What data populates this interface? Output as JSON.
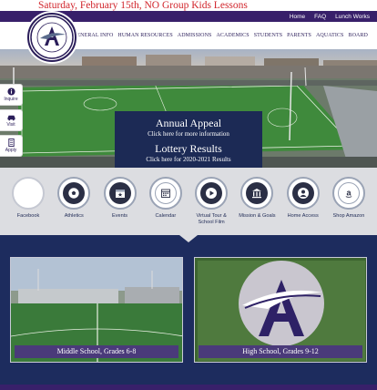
{
  "alert": {
    "text": "Saturday, February 15th, NO Group Kids Lessons"
  },
  "topbar": {
    "links": [
      "Home",
      "FAQ",
      "Lunch Works"
    ]
  },
  "logo": {
    "arc_text": "Nuusa Academy",
    "mascot_text": "Seahawks"
  },
  "nav": {
    "items": [
      "GENERAL INFO",
      "HUMAN RESOURCES",
      "ADMISSIONS",
      "ACADEMICS",
      "STUDENTS",
      "PARENTS",
      "AQUATICS",
      "BOARD"
    ]
  },
  "side_buttons": [
    {
      "label": "Inquire",
      "icon": "info-icon"
    },
    {
      "label": "Visit",
      "icon": "car-icon"
    },
    {
      "label": "Apply",
      "icon": "form-icon"
    }
  ],
  "appeal": {
    "title1": "Annual Appeal",
    "sub1": "Click here for more information",
    "title2": "Lottery Results",
    "sub2": "Click here for 2020-2021 Results"
  },
  "quick_links": [
    {
      "label": "Facebook",
      "icon": "facebook-icon"
    },
    {
      "label": "Athletics",
      "icon": "soccer-ball-icon"
    },
    {
      "label": "Events",
      "icon": "calendar-star-icon"
    },
    {
      "label": "Calendar",
      "icon": "calendar-icon"
    },
    {
      "label": "Virtual Tour & School Film",
      "icon": "play-icon"
    },
    {
      "label": "Mission & Goals",
      "icon": "building-icon"
    },
    {
      "label": "Home Access",
      "icon": "user-icon"
    },
    {
      "label": "Shop Amazon",
      "icon": "amazon-icon"
    }
  ],
  "cards": [
    {
      "caption": "Middle School, Grades 6-8"
    },
    {
      "caption": "High School, Grades 9-12"
    }
  ],
  "colors": {
    "purple": "#38206a",
    "navy": "#1d2c5e",
    "alert_red": "#d1242b",
    "grey": "#dcdde1"
  }
}
